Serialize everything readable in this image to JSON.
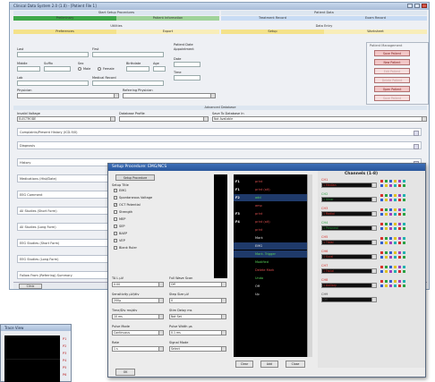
{
  "app": {
    "title": "Clinical Data System 2.0 (1.0) - [Patient File 1]"
  },
  "header": {
    "row1": [
      "Start Setup Procedures",
      "Patient Data"
    ],
    "row2_tabs": [
      {
        "label": "Preliminary",
        "color": "#3fa84a"
      },
      {
        "label": "Patient Information",
        "color": "#9fd39a"
      },
      {
        "label": "Treatment Record",
        "color": "#c8dcf4"
      },
      {
        "label": "Exam Record",
        "color": "#c8dcf4"
      }
    ],
    "row3": [
      "Utilities",
      "Data Entry"
    ],
    "row4_tabs": [
      {
        "label": "Preferences",
        "color": "#f4e28a"
      },
      {
        "label": "Export",
        "color": "#f8edb8"
      },
      {
        "label": "Setup",
        "color": "#f4e28a"
      },
      {
        "label": "Worksheet",
        "color": "#f8edb8"
      }
    ]
  },
  "patient_form": {
    "last_label": "Last",
    "first_label": "First",
    "middle_label": "Middle",
    "suffix_label": "Suffix",
    "sex_label": "Sex",
    "birthdate_label": "Birthdate",
    "age_label": "Age",
    "male_label": "Male",
    "female_label": "Female",
    "lab_label": "Lab",
    "medical_record_label": "Medical Record",
    "physician_label": "Physician",
    "referring_label": "Referring Physician",
    "patient_date_label": "Patient Date",
    "appointment_label": "Appointment",
    "date_label": "Date",
    "time_label": "Time"
  },
  "patient_mgmt": {
    "title": "Patient Management",
    "buttons": [
      "Save Patient",
      "New Patient",
      "Edit Patient",
      "Delete Patient",
      "Open Patient",
      "Save Patient"
    ]
  },
  "advanced": {
    "title": "Advanced Database",
    "cols": [
      "Invalid Voltage",
      "Database Profile",
      "Save To Database In"
    ],
    "values": [
      "ELECTRODE",
      "",
      "Not Available"
    ]
  },
  "sections": [
    "Complaints/Present History (ICD-9/0)",
    "Diagnosis",
    "History",
    "Medications (Hist/Date)",
    "EEG Comment",
    "All Studies (Short Form)",
    "All Studies (Long Form)",
    "EEG Studies (Short Form)",
    "EEG Studies (Long Form)",
    "Follow From (Referring) Summary"
  ],
  "status": {
    "text": "Clinic"
  },
  "dialog": {
    "title": "Setup Procedure: EMG/NCS",
    "tab_active": "Setup Procedure",
    "setup_title": "Setup Title",
    "checks": [
      {
        "label": "EMG",
        "on": false
      },
      {
        "label": "Spontaneous Voltage",
        "on": false
      },
      {
        "label": "OCT Potential",
        "on": true
      },
      {
        "label": "Strength",
        "on": false
      },
      {
        "label": "MEP",
        "on": false
      },
      {
        "label": "SEP",
        "on": false
      },
      {
        "label": "BAEP",
        "on": false
      },
      {
        "label": "VEP",
        "on": false
      },
      {
        "label": "Blank Ruler",
        "on": false
      }
    ],
    "left_fields": [
      {
        "label": "TA L µV",
        "value": "0.00"
      },
      {
        "label": "Sensitivity µV/div",
        "value": "200µ"
      },
      {
        "label": "Time/Div ms/div",
        "value": "10 ms"
      },
      {
        "label": "Pulse Mode",
        "value": "Continuous"
      },
      {
        "label": "Rate",
        "value": "1 s"
      }
    ],
    "right_fields": [
      {
        "label": "Full Wave Scan",
        "value": "Off"
      },
      {
        "label": "Step Size µV",
        "value": "0"
      },
      {
        "label": "Stim Delay ms",
        "value": "Not Set"
      },
      {
        "label": "Pulse Width µs",
        "value": "0.1 ms"
      },
      {
        "label": "Signal Mode",
        "value": "Select"
      }
    ],
    "ok_button": "OK",
    "commands": [
      {
        "key": "F1",
        "text": "print"
      },
      {
        "key": "F1",
        "text": "print (alt)"
      },
      {
        "key": "F2",
        "text": "add"
      },
      {
        "key": "",
        "text": "amp"
      },
      {
        "key": "F3",
        "text": "print"
      },
      {
        "key": "F4",
        "text": "print (alt)"
      },
      {
        "key": "",
        "text": "print"
      },
      {
        "key": "",
        "text": "Mark"
      },
      {
        "key": "",
        "text": "EMG"
      },
      {
        "key": "",
        "text": "Mark. Trigger"
      },
      {
        "key": "",
        "text": "Modified"
      },
      {
        "key": "",
        "text": "Delete Mark"
      },
      {
        "key": "",
        "text": "Undo"
      },
      {
        "key": "",
        "text": "Off"
      },
      {
        "key": "",
        "text": "Up"
      }
    ],
    "dlg_buttons": [
      "Clear",
      "Add",
      "Close"
    ],
    "channels_title": "Channels (1-8)",
    "channels": [
      {
        "label": "CH1",
        "value": "1 Median",
        "color": "#d8302a"
      },
      {
        "label": "CH2",
        "value": "1 Ulnar",
        "color": "#2aa040"
      },
      {
        "label": "CH3",
        "value": "1 Radial",
        "color": "#d8302a"
      },
      {
        "label": "CH4",
        "value": "1 Peroneal",
        "color": "#2aa040"
      },
      {
        "label": "CH5",
        "value": "1 Tibial",
        "color": "#d8302a"
      },
      {
        "label": "CH6",
        "value": "1 Sural",
        "color": "#d8302a"
      },
      {
        "label": "CH7",
        "value": "1 Facial",
        "color": "#d8302a"
      },
      {
        "label": "CH8",
        "value": "1 Axillary",
        "color": "#d8302a"
      },
      {
        "label": "CH9",
        "value": "Off",
        "color": "#444444"
      }
    ]
  },
  "small_window": {
    "title": "Trace View",
    "ticks": [
      "P1",
      "P2",
      "P3",
      "P4",
      "P5",
      "P6"
    ]
  }
}
